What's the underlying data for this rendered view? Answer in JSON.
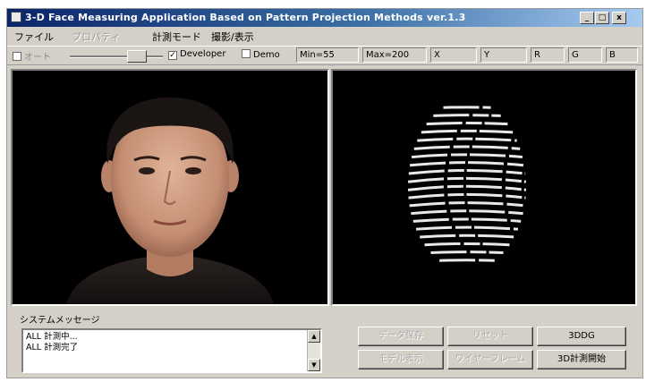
{
  "window": {
    "title": "3-D Face Measuring Application Based on Pattern Projection Methods ver.1.3",
    "controls": {
      "minimize": "_",
      "maximize": "□",
      "close": "x"
    }
  },
  "menubar": {
    "items": [
      {
        "label": "ファイル",
        "enabled": true
      },
      {
        "label": "プロパティ",
        "enabled": false
      },
      {
        "label": "計測モード",
        "enabled": true
      },
      {
        "label": "撮影/表示",
        "enabled": true
      }
    ]
  },
  "toolbar": {
    "auto_label": "オート",
    "auto_checked": false,
    "developer_label": "Developer",
    "developer_checked": true,
    "demo_label": "Demo",
    "demo_checked": false,
    "min_field": "Min=55",
    "max_field": "Max=200",
    "fields": [
      "X",
      "Y",
      "R",
      "G",
      "B"
    ]
  },
  "sysmsg": {
    "label": "システムメッセージ",
    "lines": [
      "ALL 計測中...",
      "ALL 計測完了"
    ]
  },
  "buttons": {
    "b1": "データ保存",
    "b2": "リセット",
    "b3": "3DDG",
    "b4": "モデル表示",
    "b5": "ワイヤーフレーム",
    "b6": "3D計測開始"
  }
}
